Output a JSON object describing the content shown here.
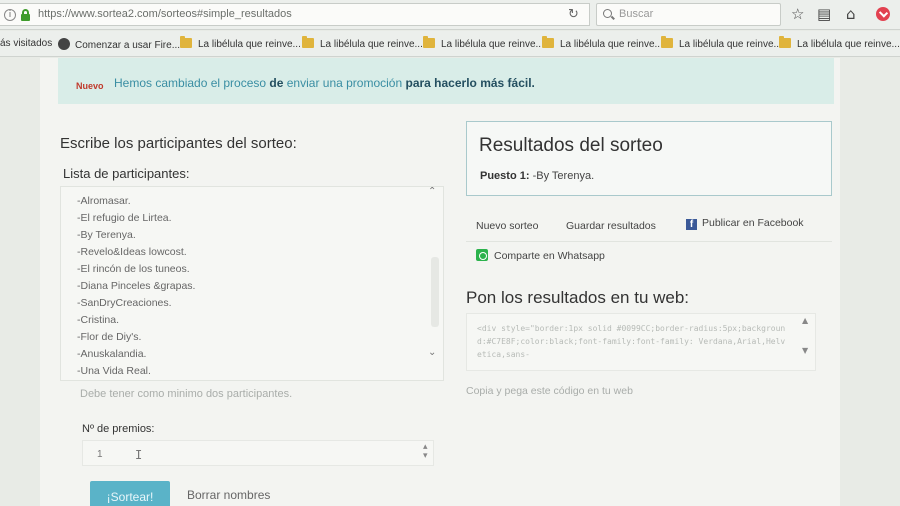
{
  "browser": {
    "url": "https://www.sortea2.com/sorteos#simple_resultados",
    "search_placeholder": "Buscar",
    "bookmarks": [
      "ás visitados",
      "Comenzar a usar Fire...",
      "La libélula que reinve...",
      "La libélula que reinve...",
      "La libélula que reinve...",
      "La libélula que reinve...",
      "La libélula que reinve...",
      "La libélula que reinve..."
    ]
  },
  "notice": {
    "badge": "Nuevo",
    "text_link1": "Hemos cambiado el proceso",
    "text_mid1": " de ",
    "text_link2": "enviar una promoción",
    "text_bold": " para hacerlo más fácil."
  },
  "participants": {
    "heading": "Escribe los participantes del sorteo:",
    "list_label": "Lista de participantes:",
    "entries": [
      "-Alromasar.",
      "-El refugio de Lirtea.",
      "-By Terenya.",
      "-Revelo&Ideas lowcost.",
      "-El rincón de los tuneos.",
      "-Diana Pinceles &grapas.",
      "-SanDryCreaciones.",
      "-Cristina.",
      "-Flor de Diy's.",
      "-Anuskalandia.",
      "-Una Vida Real."
    ],
    "hint": "Debe tener como minimo dos participantes.",
    "prizes_label": "Nº de premios:",
    "prizes_value": "1",
    "raffle_button": "¡Sortear!",
    "clear_link": "Borrar nombres"
  },
  "results": {
    "title": "Resultados del sorteo",
    "position_label": "Puesto 1:",
    "position_value": " -By Terenya.",
    "new_raffle": "Nuevo sorteo",
    "save_results": "Guardar resultados",
    "publish_facebook": "Publicar en Facebook",
    "share_whatsapp": "Comparte en Whatsapp",
    "web_heading": "Pon los resultados en tu web:",
    "code": "<div style=\"border:1px solid #0099CC;border-radius:5px;background:#C7E8F;color:black;font-family:font-family: Verdana,Arial,Helvetica,sans-",
    "code_hint": "Copia y pega este código en tu web"
  }
}
